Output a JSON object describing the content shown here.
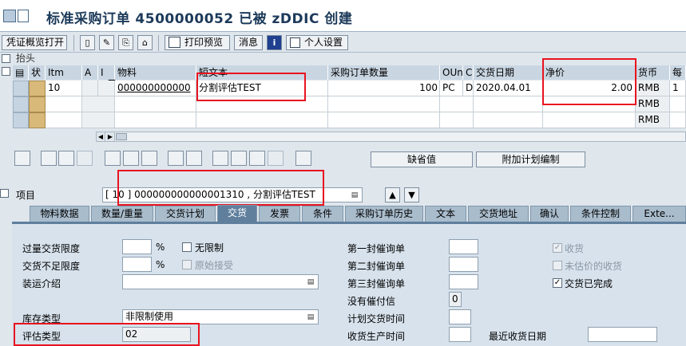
{
  "title": "标准采购订单 4500000052 已被 zDDIC 创建",
  "toolbar": {
    "overview_btn": "凭证概览打开",
    "print_preview": "打印预览",
    "messages": "消息",
    "personal_settings": "个人设置"
  },
  "table": {
    "section_label": "抬头",
    "headers": [
      "状",
      "Itm",
      "A",
      "I",
      "物料",
      "短文本",
      "采购订单数量",
      "OUn",
      "C",
      "交货日期",
      "净价",
      "货币",
      "每"
    ],
    "rows": [
      [
        "",
        "10",
        "",
        "",
        "000000000000",
        "分割评估TEST",
        "100",
        "PC",
        "D",
        "2020.04.01",
        "2.00",
        "RMB",
        "1"
      ],
      [
        "",
        "",
        "",
        "",
        "",
        "",
        "",
        "",
        "",
        "",
        "",
        "RMB",
        ""
      ],
      [
        "",
        "",
        "",
        "",
        "",
        "",
        "",
        "",
        "",
        "",
        "",
        "RMB",
        ""
      ]
    ]
  },
  "buttons": {
    "default_values": "缺省值",
    "additional_planning": "附加计划编制"
  },
  "item": {
    "label": "项目",
    "value": "[ 10 ] 000000000000001310 , 分割评估TEST"
  },
  "tabs": [
    "物料数据",
    "数量/重量",
    "交货计划",
    "交货",
    "发票",
    "条件",
    "采购订单历史",
    "文本",
    "交货地址",
    "确认",
    "条件控制",
    "Exte..."
  ],
  "active_tab": "交货",
  "delivery": {
    "overdelivery_label": "过量交货限度",
    "overdelivery_unit": "%",
    "unlimited_label": "无限制",
    "underdelivery_label": "交货不足限度",
    "underdelivery_unit": "%",
    "original_accept_label": "原始接受",
    "shipping_instr_label": "装运介绍",
    "stock_type_label": "库存类型",
    "stock_type_value": "非限制使用",
    "valuation_type_label": "评估类型",
    "valuation_type_value": "02",
    "reminder1_label": "第一封催询单",
    "reminder2_label": "第二封催询单",
    "reminder3_label": "第三封催询单",
    "no_exped_label": "没有催付信",
    "no_exped_value": "0",
    "planned_time_label": "计划交货时间",
    "gr_proc_time_label": "收货生产时间",
    "last_gr_date_label": "最近收货日期",
    "gr_label": "收货",
    "non_valuated_gr_label": "未估价的收货",
    "delivery_complete_label": "交货已完成"
  }
}
